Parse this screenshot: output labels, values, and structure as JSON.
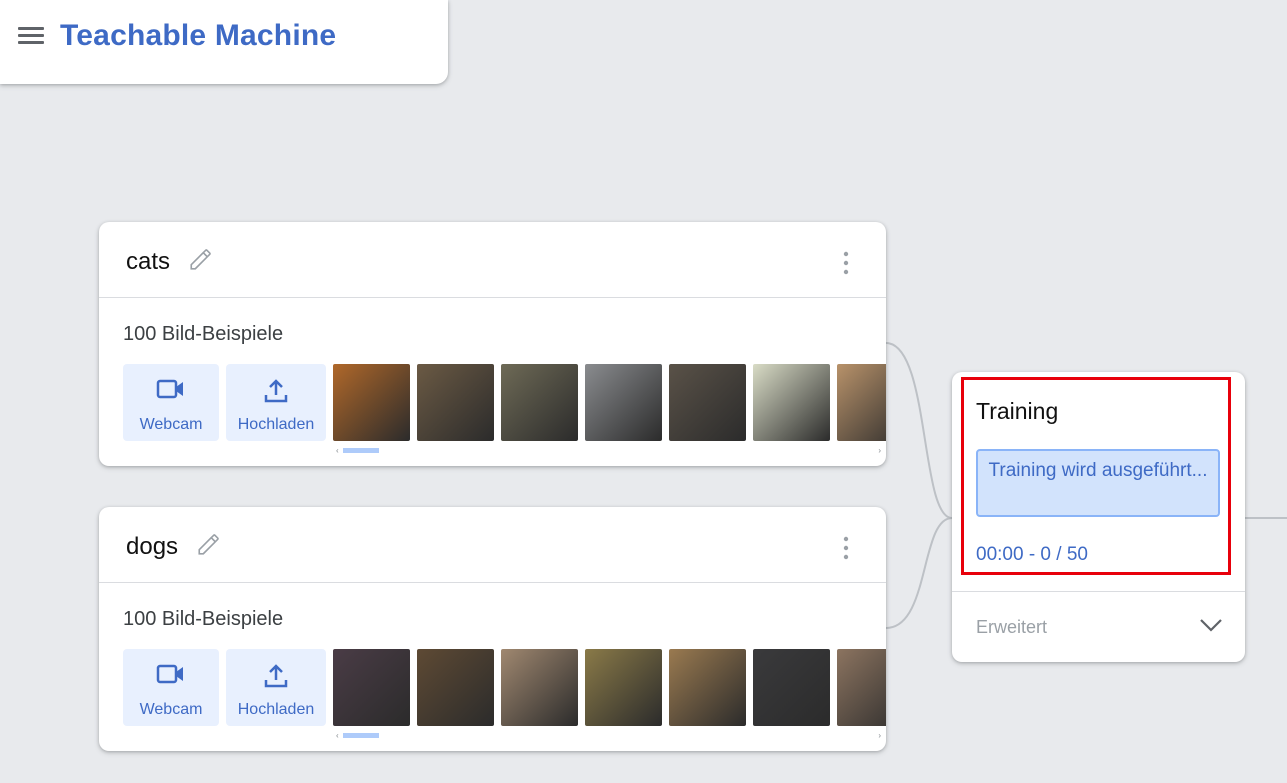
{
  "header": {
    "app_title": "Teachable Machine"
  },
  "classes": [
    {
      "name": "cats",
      "sample_count": "100 Bild-Beispiele",
      "webcam_label": "Webcam",
      "upload_label": "Hochladen",
      "thumb_colors": [
        "#b0682a",
        "#6b5a44",
        "#6e6a56",
        "#8a8c8f",
        "#5a5248",
        "#d9dcc6",
        "#b8926a"
      ]
    },
    {
      "name": "dogs",
      "sample_count": "100 Bild-Beispiele",
      "webcam_label": "Webcam",
      "upload_label": "Hochladen",
      "thumb_colors": [
        "#4a3c46",
        "#5e4a34",
        "#a08870",
        "#8a7a48",
        "#9a7a50",
        "#3a3a3c",
        "#8c7460"
      ]
    }
  ],
  "training": {
    "title": "Training",
    "status_button": "Training wird ausgeführt...",
    "progress": "00:00 - 0 / 50",
    "advanced_label": "Erweitert"
  },
  "colors": {
    "accent": "#3e6ac5",
    "highlight": "#e8000b",
    "button_bg": "#e8f0fe"
  }
}
